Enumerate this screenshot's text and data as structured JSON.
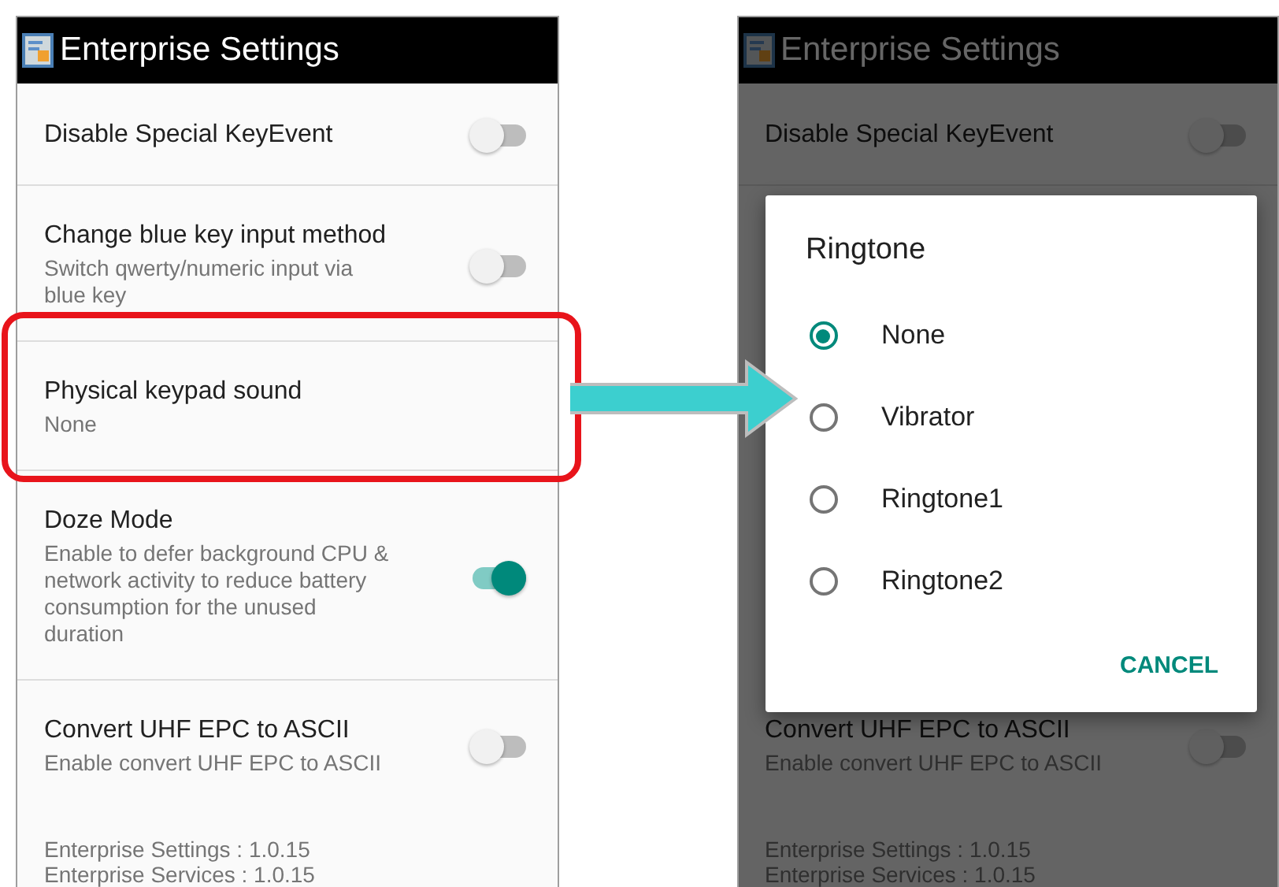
{
  "screens": [
    {
      "title": "Enterprise Settings",
      "dimmed": false,
      "rows": [
        {
          "kind": "switch",
          "title": "Disable Special KeyEvent",
          "on": false
        },
        {
          "kind": "switch",
          "title": "Change blue key input method",
          "summary": "Switch qwerty/numeric input via blue key",
          "on": false
        },
        {
          "kind": "list",
          "title": "Physical keypad sound",
          "summary": "None"
        },
        {
          "kind": "switch",
          "title": "Doze Mode",
          "summary": "Enable to defer background CPU & network activity to reduce battery consumption for the unused duration",
          "on": true
        },
        {
          "kind": "switch",
          "title": "Convert UHF EPC to ASCII",
          "summary": "Enable convert UHF EPC to ASCII",
          "on": false
        }
      ],
      "footer": [
        "Enterprise Settings : 1.0.15",
        "Enterprise Services : 1.0.15"
      ]
    },
    {
      "title": "Enterprise Settings",
      "dimmed": true,
      "rows": [
        {
          "kind": "switch",
          "title": "Disable Special KeyEvent",
          "on": false
        },
        {
          "kind": "switch",
          "title": "Convert UHF EPC to ASCII",
          "summary": "Enable convert UHF EPC to ASCII",
          "on": false
        }
      ],
      "footer": [
        "Enterprise Settings : 1.0.15",
        "Enterprise Services : 1.0.15"
      ],
      "dialog": {
        "title": "Ringtone",
        "options": [
          {
            "label": "None",
            "selected": true
          },
          {
            "label": "Vibrator",
            "selected": false
          },
          {
            "label": "Ringtone1",
            "selected": false
          },
          {
            "label": "Ringtone2",
            "selected": false
          }
        ],
        "button": "CANCEL"
      }
    }
  ]
}
